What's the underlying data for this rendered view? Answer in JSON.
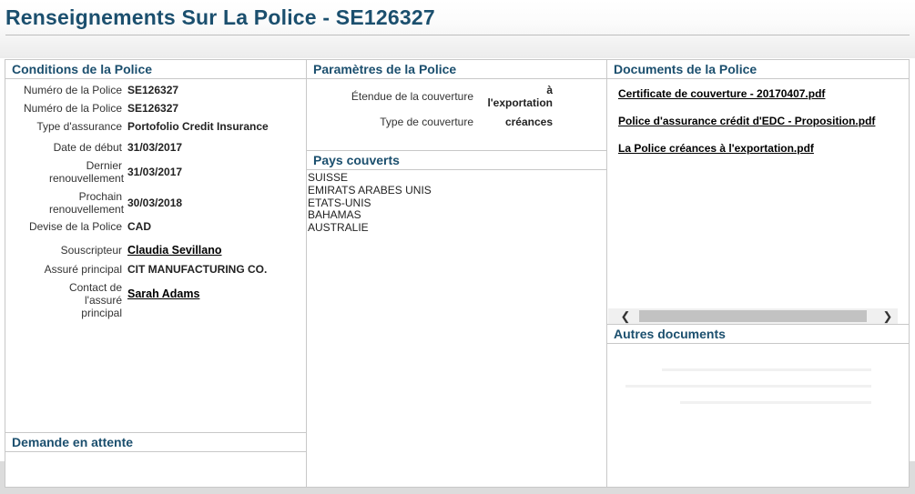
{
  "page": {
    "title": "Renseignements Sur La Police - SE126327"
  },
  "conditions": {
    "title": "Conditions de la Police",
    "fields": [
      {
        "label": "Numéro de la Police",
        "value": "SE126327"
      },
      {
        "label": "Numéro de la Police",
        "value": "SE126327"
      },
      {
        "label": "Type d'assurance",
        "value": "Portofolio Credit Insurance"
      },
      {
        "label": "Date de début",
        "value": "31/03/2017"
      },
      {
        "label": "Dernier renouvellement",
        "value": "31/03/2017"
      },
      {
        "label": "Prochain renouvellement",
        "value": "30/03/2018"
      },
      {
        "label": "Devise de la Police",
        "value": "CAD"
      },
      {
        "label": "Souscripteur",
        "value": "Claudia Sevillano"
      },
      {
        "label": "Assuré principal",
        "value": "CIT MANUFACTURING CO."
      },
      {
        "label": "Contact de l'assuré principal",
        "value": "Sarah Adams"
      }
    ]
  },
  "pending": {
    "title": "Demande en attente"
  },
  "parameters": {
    "title": "Paramètres de la Police",
    "rows": [
      {
        "label": "Étendue de la couverture",
        "value": "à l'exportation"
      },
      {
        "label": "Type de couverture",
        "value": "créances"
      }
    ]
  },
  "countries": {
    "title": "Pays couverts",
    "items": [
      "SUISSE",
      "EMIRATS ARABES UNIS",
      "ETATS-UNIS",
      "BAHAMAS",
      "AUSTRALIE"
    ]
  },
  "documents": {
    "title": "Documents de la Police",
    "items": [
      "Certificate de couverture - 20170407.pdf",
      "Police d'assurance crédit d'EDC - Proposition.pdf",
      "La Police créances à l'exportation.pdf"
    ],
    "scroll_left": "❮",
    "scroll_right": "❯"
  },
  "other_documents": {
    "title": "Autres documents"
  }
}
